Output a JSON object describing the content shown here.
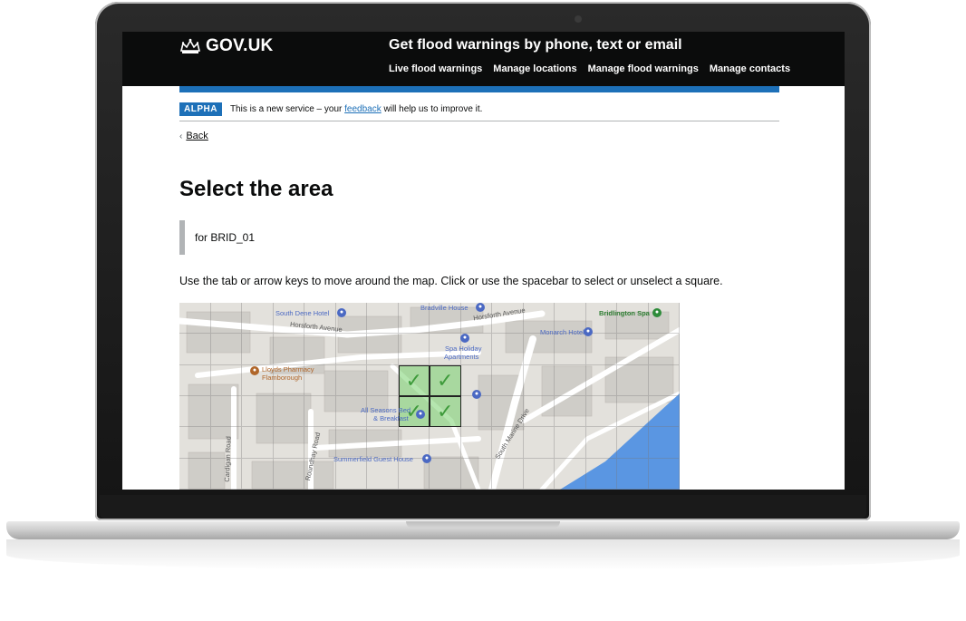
{
  "header": {
    "logo_text": "GOV.UK",
    "service_name": "Get flood warnings by phone, text or email",
    "nav": [
      "Live flood warnings",
      "Manage locations",
      "Manage flood warnings",
      "Manage contacts"
    ]
  },
  "phase_banner": {
    "tag": "ALPHA",
    "text_before": "This is a new service – your",
    "link_text": "feedback",
    "text_after": "will help us to improve it."
  },
  "back_link": "Back",
  "page_title": "Select the area",
  "inset_text": "for BRID_01",
  "hint": "Use the tab or arrow keys to move around the map. Click or use the spacebar to select or unselect a square.",
  "map": {
    "labels": {
      "bradville_house": "Bradville House",
      "south_dene_hotel": "South Dene Hotel",
      "horsforth_avenue_w": "Horsforth Avenue",
      "horsforth_avenue_e": "Horsforth Avenue",
      "bridlington_spa": "Bridlington Spa",
      "monarch_hotel": "Monarch Hotel",
      "spa_holiday": "Spa Holiday",
      "apartments": "Apartments",
      "lloyds_pharmacy": "Lloyds Pharmacy",
      "flamborough": "Flamborough",
      "all_seasons": "All Seasons Bed",
      "breakfast": "& Breakfast",
      "summerfield": "Summerfield Guest House",
      "south_marine_drive": "South Marine Drive",
      "cardigan_road": "Cardigan Road",
      "roundhay_road": "Roundhay Road"
    },
    "selected_cells": 4
  },
  "colors": {
    "header_bg": "#0b0c0c",
    "brand_blue": "#1d70b8",
    "selection_green": "#78d26e",
    "sea": "#5a96e2"
  }
}
